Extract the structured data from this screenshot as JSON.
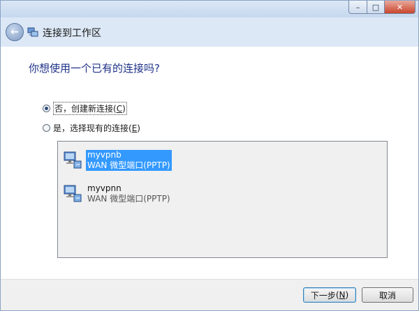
{
  "window": {
    "caption": {
      "minimize": "–",
      "maximize": "□",
      "close": "✕"
    }
  },
  "header": {
    "back_glyph": "←",
    "title": "连接到工作区"
  },
  "main": {
    "question": "你想使用一个已有的连接吗?",
    "options": [
      {
        "label": "否，创建新连接",
        "accesskey": "C",
        "checked": true
      },
      {
        "label": "是，选择现有的连接",
        "accesskey": "E",
        "checked": false
      }
    ],
    "connections": [
      {
        "name": "myvpnb",
        "type": "WAN 微型端口(PPTP)",
        "selected": true
      },
      {
        "name": "myvpnn",
        "type": "WAN 微型端口(PPTP)",
        "selected": false
      }
    ]
  },
  "footer": {
    "next_label": "下一步",
    "next_accesskey": "N",
    "cancel_label": "取消"
  },
  "icons": {
    "back": "back-arrow-icon",
    "network": "network-connection-icon",
    "connection": "vpn-connection-icon"
  },
  "colors": {
    "header_bg": "#dce8f6",
    "question_text": "#1e3287",
    "selection": "#3399ff"
  }
}
